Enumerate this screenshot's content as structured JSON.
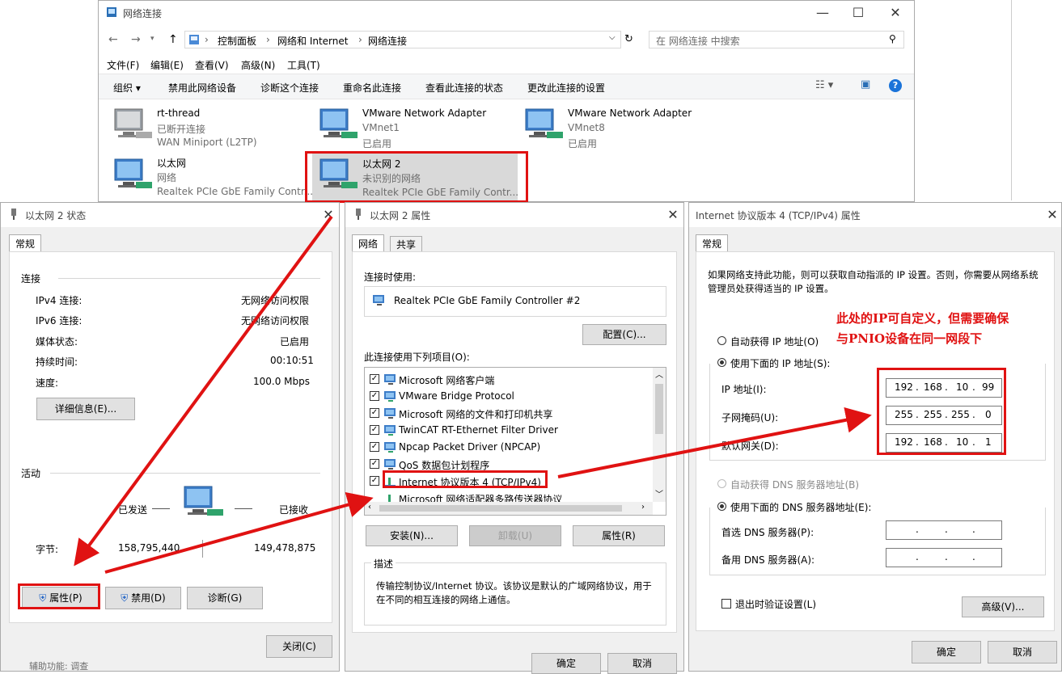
{
  "explorer": {
    "title": "网络连接",
    "breadcrumb": [
      "控制面板",
      "网络和 Internet",
      "网络连接"
    ],
    "search_placeholder": "在 网络连接 中搜索",
    "menu": [
      "文件(F)",
      "编辑(E)",
      "查看(V)",
      "高级(N)",
      "工具(T)"
    ],
    "toolbar": [
      "组织 ▾",
      "禁用此网络设备",
      "诊断这个连接",
      "重命名此连接",
      "查看此连接的状态",
      "更改此连接的设置"
    ],
    "items": [
      {
        "name": "rt-thread",
        "status": "已断开连接",
        "device": "WAN Miniport (L2TP)"
      },
      {
        "name": "VMware Network Adapter",
        "status": "VMnet1",
        "device": "已启用"
      },
      {
        "name": "VMware Network Adapter",
        "status": "VMnet8",
        "device": "已启用"
      },
      {
        "name": "以太网",
        "status": "网络",
        "device": "Realtek PCIe GbE Family Contr..."
      },
      {
        "name": "以太网 2",
        "status": "未识别的网络",
        "device": "Realtek PCIe GbE Family Contr..."
      }
    ]
  },
  "status_dialog": {
    "title": "以太网 2 状态",
    "tab": "常规",
    "conn_header": "连接",
    "rows": [
      {
        "label": "IPv4 连接:",
        "value": "无网络访问权限"
      },
      {
        "label": "IPv6 连接:",
        "value": "无网络访问权限"
      },
      {
        "label": "媒体状态:",
        "value": "已启用"
      },
      {
        "label": "持续时间:",
        "value": "00:10:51"
      },
      {
        "label": "速度:",
        "value": "100.0 Mbps"
      }
    ],
    "details_button": "详细信息(E)...",
    "activity_header": "活动",
    "sent_label": "已发送",
    "recv_label": "已接收",
    "bytes_label": "字节:",
    "bytes_sent": "158,795,440",
    "bytes_recv": "149,478,875",
    "properties_button": "属性(P)",
    "disable_button": "禁用(D)",
    "diagnose_button": "诊断(G)",
    "close_button": "关闭(C)"
  },
  "props_dialog": {
    "title": "以太网 2 属性",
    "tab_network": "网络",
    "tab_share": "共享",
    "connect_using_label": "连接时使用:",
    "adapter": "Realtek PCIe GbE Family Controller #2",
    "configure_button": "配置(C)...",
    "items_label": "此连接使用下列项目(O):",
    "items": [
      "Microsoft 网络客户端",
      "VMware Bridge Protocol",
      "Microsoft 网络的文件和打印机共享",
      "TwinCAT RT-Ethernet Filter Driver",
      "Npcap Packet Driver (NPCAP)",
      "QoS 数据包计划程序",
      "Internet 协议版本 4 (TCP/IPv4)",
      "Microsoft 网络适配器多路传送器协议"
    ],
    "install_button": "安装(N)...",
    "uninstall_button": "卸载(U)",
    "properties_button": "属性(R)",
    "desc_header": "描述",
    "description": "传输控制协议/Internet 协议。该协议是默认的广域网络协议，用于在不同的相互连接的网络上通信。",
    "ok_button": "确定",
    "cancel_button": "取消"
  },
  "ipv4_dialog": {
    "title": "Internet 协议版本 4 (TCP/IPv4) 属性",
    "tab": "常规",
    "intro": "如果网络支持此功能，则可以获取自动指派的 IP 设置。否则，你需要从网络系统管理员处获得适当的 IP 设置。",
    "auto_ip_label": "自动获得 IP 地址(O)",
    "use_ip_label": "使用下面的 IP 地址(S):",
    "ip_label": "IP 地址(I):",
    "ip": [
      "192",
      "168",
      "10",
      "99"
    ],
    "mask_label": "子网掩码(U):",
    "mask": [
      "255",
      "255",
      "255",
      "0"
    ],
    "gateway_label": "默认网关(D):",
    "gateway": [
      "192",
      "168",
      "10",
      "1"
    ],
    "auto_dns_label": "自动获得 DNS 服务器地址(B)",
    "use_dns_label": "使用下面的 DNS 服务器地址(E):",
    "dns1_label": "首选 DNS 服务器(P):",
    "dns2_label": "备用 DNS 服务器(A):",
    "validate_label": "退出时验证设置(L)",
    "advanced_button": "高级(V)...",
    "ok_button": "确定",
    "cancel_button": "取消"
  },
  "annotation": {
    "line1": "此处的IP可自定义，但需要确保",
    "line2": "与PNIO设备在同一网段下",
    "color": "#e01212"
  },
  "footer_text": "辅助功能: 调查"
}
